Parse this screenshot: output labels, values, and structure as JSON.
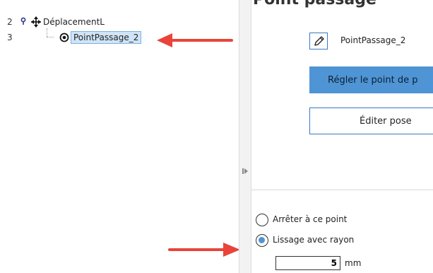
{
  "tree": {
    "rows": [
      {
        "line": "2",
        "label": "DéplacementL",
        "icons": [
          "pin-icon",
          "move-icon"
        ]
      },
      {
        "line": "3",
        "label": "PointPassage_2",
        "icons": [
          "waypoint-icon"
        ],
        "selected": true
      }
    ]
  },
  "panel": {
    "title": "Point passage",
    "name_field": {
      "icon": "pencil-icon",
      "value": "PointPassage_2"
    },
    "set_point_button": "Régler le point de p",
    "edit_pose_button": "Éditer pose",
    "stop_option": "Arrêter à ce point",
    "blend_option": "Lissage avec rayon",
    "blend_selected": "blend",
    "radius_value": "5",
    "radius_unit": "mm"
  },
  "colors": {
    "accent": "#4f94d4",
    "selection_bg": "#cfe4f7",
    "annotation_arrow": "#e8443a"
  }
}
